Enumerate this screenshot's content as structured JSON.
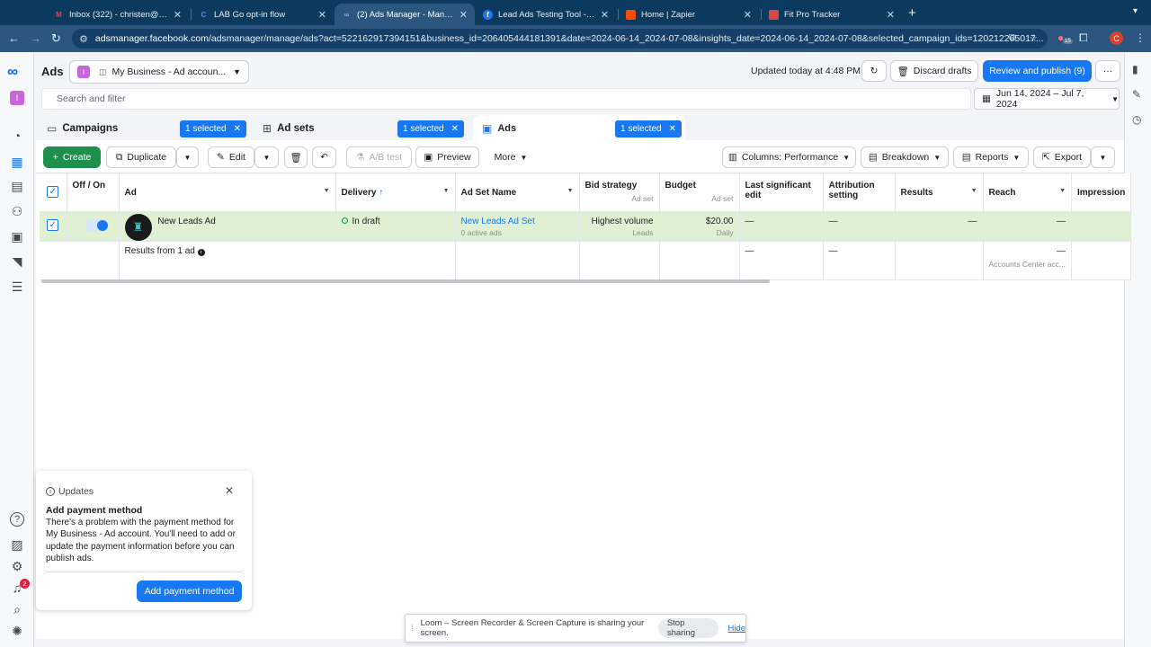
{
  "browser": {
    "tabs": [
      {
        "title": "Inbox (322) - christen@ignitio",
        "favicon_color": "#ea4335",
        "favicon": "M"
      },
      {
        "title": "LAB Go opt-in flow",
        "favicon_color": "#5f8de8",
        "favicon": "C"
      },
      {
        "title": "(2) Ads Manager - Manage ads",
        "favicon_color": "#0866ff",
        "favicon": "∞"
      },
      {
        "title": "Lead Ads Testing Tool - Meta",
        "favicon_color": "#1877f2",
        "favicon": "f"
      },
      {
        "title": "Home | Zapier",
        "favicon_color": "#ff4a00",
        "favicon": ""
      },
      {
        "title": "Fit Pro Tracker",
        "favicon_color": "#e04545",
        "favicon": ""
      }
    ],
    "url_host": "adsmanager.facebook.com",
    "url_path": "/adsmanager/manage/ads?act=522162917394151&business_id=206405444181391&date=2024-06-14_2024-07-08&insights_date=2024-06-14_2024-07-08&selected_campaign_ids=120212265017...",
    "extension_badge": "15",
    "profile_initial": "C"
  },
  "header": {
    "title": "Ads",
    "account_initial": "I",
    "account_name": "My Business - Ad accoun...",
    "updated": "Updated today at 4:48 PM",
    "discard_label": "Discard drafts",
    "publish_label": "Review and publish (9)"
  },
  "search": {
    "placeholder": "Search and filter"
  },
  "date_range": "Jun 14, 2024 – Jul 7, 2024",
  "levels": [
    {
      "name": "Campaigns",
      "selected": "1 selected"
    },
    {
      "name": "Ad sets",
      "selected": "1 selected"
    },
    {
      "name": "Ads",
      "selected": "1 selected"
    }
  ],
  "toolbar": {
    "create": "Create",
    "duplicate": "Duplicate",
    "edit": "Edit",
    "ab_test": "A/B test",
    "preview": "Preview",
    "more": "More",
    "columns": "Columns: Performance",
    "breakdown": "Breakdown",
    "reports": "Reports",
    "export": "Export"
  },
  "table": {
    "headers": {
      "offon": "Off / On",
      "ad": "Ad",
      "delivery": "Delivery",
      "delivery_sort": "↑",
      "adset": "Ad Set Name",
      "bid": "Bid strategy",
      "bid_sub": "Ad set",
      "budget": "Budget",
      "budget_sub": "Ad set",
      "last_edit": "Last significant edit",
      "attribution": "Attribution setting",
      "results": "Results",
      "reach": "Reach",
      "impressions": "Impression"
    },
    "row": {
      "ad_name": "New Leads Ad",
      "delivery": "In draft",
      "adset_name": "New Leads Ad Set",
      "adset_sub": "0 active ads",
      "bid": "Highest volume",
      "bid_sub": "Leads",
      "budget": "$20.00",
      "budget_sub": "Daily",
      "last_edit": "—",
      "attribution": "—",
      "results": "—",
      "reach": "—"
    },
    "summary": {
      "label": "Results from 1 ad",
      "last_edit": "—",
      "attribution": "—",
      "reach": "—",
      "reach_sub": "Accounts Center acc..."
    }
  },
  "popup": {
    "header": "Updates",
    "title": "Add payment method",
    "body": "There's a problem with the payment method for My Business - Ad account. You'll need to add or update the payment information before you can publish ads.",
    "button": "Add payment method"
  },
  "notification_count": "2",
  "loom": {
    "message": "Loom – Screen Recorder & Screen Capture is sharing your screen.",
    "stop": "Stop sharing",
    "hide": "Hide"
  }
}
